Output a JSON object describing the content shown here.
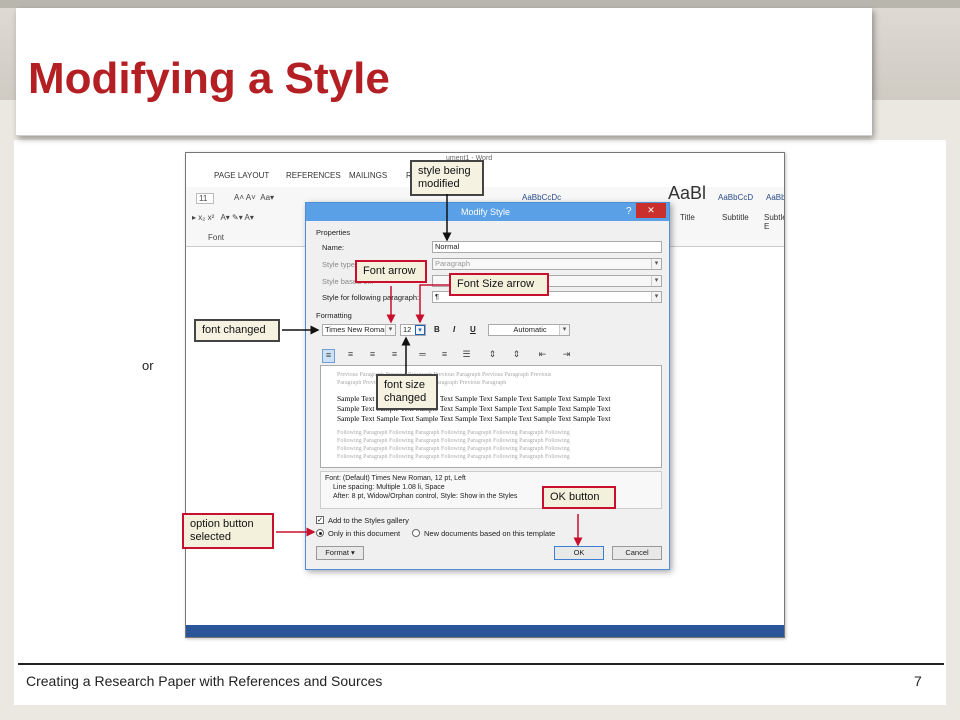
{
  "slide": {
    "title": "Modifying a Style",
    "footer": "Creating a Research Paper with References and Sources",
    "page_number": "7"
  },
  "word": {
    "doc_title": "ument1 - Word",
    "tabs": [
      "PAGE LAYOUT",
      "REFERENCES",
      "MAILINGS",
      "R"
    ],
    "font_size": "11",
    "group_font": "Font",
    "styles": [
      {
        "sample": "AaBbCcDc",
        "name": ""
      },
      {
        "sample": "AaBl",
        "name": "Title"
      },
      {
        "sample": "AaBbCcD",
        "name": "Subtitle"
      },
      {
        "sample": "AaBbCcD",
        "name": "Subtle E"
      }
    ],
    "body_fragment": "or"
  },
  "dialog": {
    "title": "Modify Style",
    "help": "?",
    "close": "✕",
    "properties_label": "Properties",
    "name_label": "Name:",
    "name_value": "Normal",
    "style_type_label": "Style type:",
    "style_type_value": "Paragraph",
    "style_based_label": "Style based on:",
    "following_label": "Style for following paragraph:",
    "following_value": "¶",
    "formatting_label": "Formatting",
    "font_value": "Times New Roman",
    "size_value": "12",
    "bold": "B",
    "italic": "I",
    "underline": "U",
    "color_value": "Automatic",
    "preview_previous": "Previous Paragraph Previous Paragraph Previous Paragraph Previous Paragraph Previous",
    "preview_previous2": "Paragraph Previous Paragraph Previous Paragraph Previous Paragraph",
    "preview_sample": "Sample Text Sample Text Sample Text Sample Text Sample Text Sample Text Sample Text",
    "preview_following": "Following Paragraph Following Paragraph Following Paragraph Following Paragraph Following",
    "description_line1": "Font: (Default) Times New Roman, 12 pt, Left",
    "description_line2": "Line spacing:  Multiple 1.08 li, Space",
    "description_line3": "After:  8 pt, Widow/Orphan control, Style: Show in the Styles",
    "add_gallery": "Add to the Styles gallery",
    "only_doc": "Only in this document",
    "new_docs": "New documents based on this template",
    "format_button": "Format ▾",
    "ok_button": "OK",
    "cancel_button": "Cancel"
  },
  "callouts": {
    "style_modified": "style being modified",
    "font_arrow": "Font arrow",
    "font_size_arrow": "Font Size arrow",
    "font_changed": "font changed",
    "font_size_changed": "font size changed",
    "ok_button": "OK button",
    "option_selected": "option button selected"
  },
  "colors": {
    "title_red": "#b41f24",
    "callout_border": "#c8102e",
    "dialog_titlebar": "#5aa0e6",
    "word_blue": "#2a5699"
  }
}
